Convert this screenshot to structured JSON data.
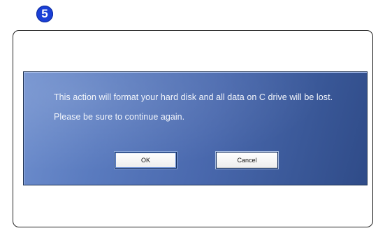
{
  "step_number": "5",
  "dialog": {
    "message": "This action will format your hard disk and all data on C drive will be lost. Please be sure to continue again.",
    "ok_label": "OK",
    "cancel_label": "Cancel"
  },
  "colors": {
    "badge": "#1a3fd6",
    "dialog_light": "#6f8fce",
    "dialog_dark": "#2f4b88",
    "text": "#f2f5fb"
  }
}
